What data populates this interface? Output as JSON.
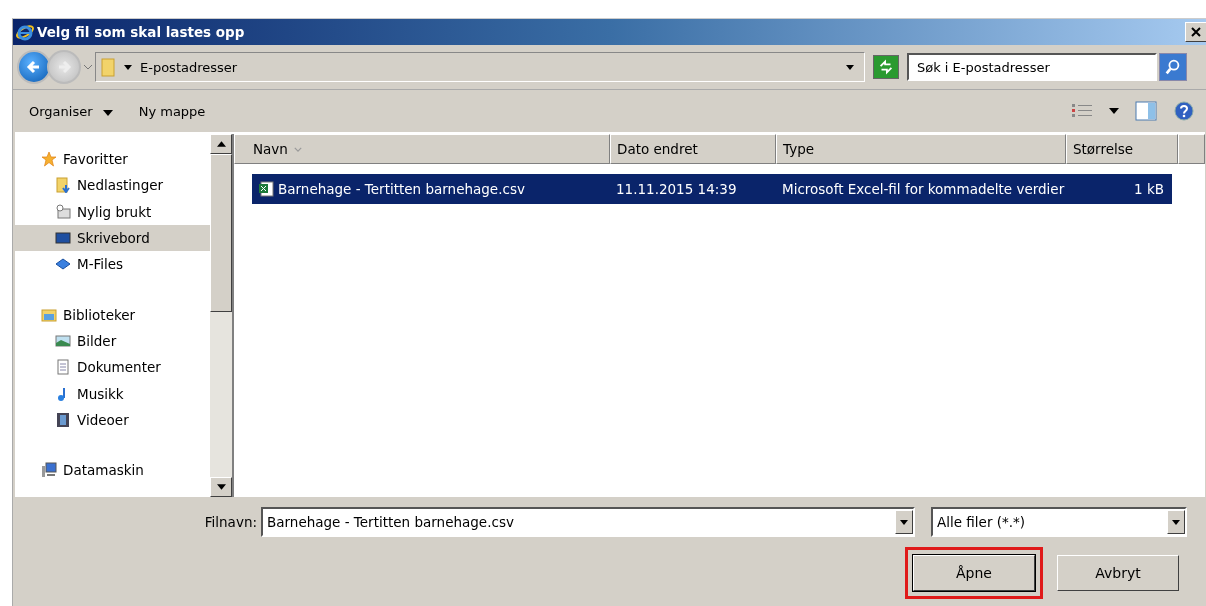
{
  "window": {
    "title": "Velg fil som skal lastes opp"
  },
  "address_bar": {
    "path": "E-postadresser"
  },
  "search": {
    "placeholder": "Søk i E-postadresser"
  },
  "toolbar": {
    "organize": "Organiser",
    "new_folder": "Ny mappe"
  },
  "sidebar": {
    "groups": [
      {
        "label": "Favoritter",
        "kind": "star",
        "children": [
          {
            "label": "Nedlastinger",
            "kind": "downloads",
            "selected": false
          },
          {
            "label": "Nylig brukt",
            "kind": "recent",
            "selected": false
          },
          {
            "label": "Skrivebord",
            "kind": "desktop",
            "selected": true
          },
          {
            "label": "M-Files",
            "kind": "mfiles",
            "selected": false
          }
        ]
      },
      {
        "label": "Biblioteker",
        "kind": "library",
        "children": [
          {
            "label": "Bilder",
            "kind": "pictures",
            "selected": false
          },
          {
            "label": "Dokumenter",
            "kind": "documents",
            "selected": false
          },
          {
            "label": "Musikk",
            "kind": "music",
            "selected": false
          },
          {
            "label": "Videoer",
            "kind": "videos",
            "selected": false
          }
        ]
      },
      {
        "label": "Datamaskin",
        "kind": "computer"
      }
    ]
  },
  "table": {
    "columns": [
      {
        "label": "Navn",
        "sort": true
      },
      {
        "label": "Dato endret",
        "sort": false
      },
      {
        "label": "Type",
        "sort": false
      },
      {
        "label": "Størrelse",
        "sort": false
      }
    ],
    "rows": [
      {
        "name": "Barnehage - Tertitten barnehage.csv",
        "date": "11.11.2015 14:39",
        "type": "Microsoft Excel-fil for kommadelte verdier",
        "size": "1 kB",
        "selected": true
      }
    ]
  },
  "filename": {
    "label": "Filnavn:",
    "value": "Barnehage - Tertitten barnehage.csv"
  },
  "filter": {
    "value": "Alle filer (*.*)"
  },
  "buttons": [
    {
      "label": "Åpne",
      "highlighted": true
    },
    {
      "label": "Avbryt",
      "highlighted": false
    }
  ]
}
